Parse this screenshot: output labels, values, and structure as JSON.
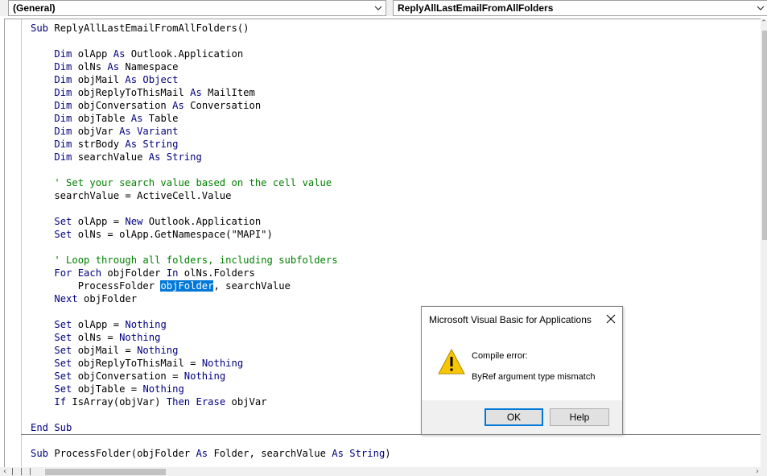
{
  "toolbar": {
    "object_combo": "(General)",
    "procedure_combo": "ReplyAllLastEmailFromAllFolders"
  },
  "code": {
    "lines": [
      [
        {
          "t": "Sub ",
          "c": "kw"
        },
        {
          "t": "ReplyAllLastEmailFromAllFolders()"
        }
      ],
      [],
      [
        {
          "t": "    "
        },
        {
          "t": "Dim",
          "c": "kw"
        },
        {
          "t": " olApp "
        },
        {
          "t": "As",
          "c": "kw"
        },
        {
          "t": " Outlook.Application"
        }
      ],
      [
        {
          "t": "    "
        },
        {
          "t": "Dim",
          "c": "kw"
        },
        {
          "t": " olNs "
        },
        {
          "t": "As",
          "c": "kw"
        },
        {
          "t": " Namespace"
        }
      ],
      [
        {
          "t": "    "
        },
        {
          "t": "Dim",
          "c": "kw"
        },
        {
          "t": " objMail "
        },
        {
          "t": "As Object",
          "c": "kw"
        }
      ],
      [
        {
          "t": "    "
        },
        {
          "t": "Dim",
          "c": "kw"
        },
        {
          "t": " objReplyToThisMail "
        },
        {
          "t": "As",
          "c": "kw"
        },
        {
          "t": " MailItem"
        }
      ],
      [
        {
          "t": "    "
        },
        {
          "t": "Dim",
          "c": "kw"
        },
        {
          "t": " objConversation "
        },
        {
          "t": "As",
          "c": "kw"
        },
        {
          "t": " Conversation"
        }
      ],
      [
        {
          "t": "    "
        },
        {
          "t": "Dim",
          "c": "kw"
        },
        {
          "t": " objTable "
        },
        {
          "t": "As",
          "c": "kw"
        },
        {
          "t": " Table"
        }
      ],
      [
        {
          "t": "    "
        },
        {
          "t": "Dim",
          "c": "kw"
        },
        {
          "t": " objVar "
        },
        {
          "t": "As Variant",
          "c": "kw"
        }
      ],
      [
        {
          "t": "    "
        },
        {
          "t": "Dim",
          "c": "kw"
        },
        {
          "t": " strBody "
        },
        {
          "t": "As String",
          "c": "kw"
        }
      ],
      [
        {
          "t": "    "
        },
        {
          "t": "Dim",
          "c": "kw"
        },
        {
          "t": " searchValue "
        },
        {
          "t": "As String",
          "c": "kw"
        }
      ],
      [],
      [
        {
          "t": "    "
        },
        {
          "t": "' Set your search value based on the cell value",
          "c": "cm"
        }
      ],
      [
        {
          "t": "    searchValue = ActiveCell.Value"
        }
      ],
      [],
      [
        {
          "t": "    "
        },
        {
          "t": "Set",
          "c": "kw"
        },
        {
          "t": " olApp = "
        },
        {
          "t": "New",
          "c": "kw"
        },
        {
          "t": " Outlook.Application"
        }
      ],
      [
        {
          "t": "    "
        },
        {
          "t": "Set",
          "c": "kw"
        },
        {
          "t": " olNs = olApp.GetNamespace(\"MAPI\")"
        }
      ],
      [],
      [
        {
          "t": "    "
        },
        {
          "t": "' Loop through all folders, including subfolders",
          "c": "cm"
        }
      ],
      [
        {
          "t": "    "
        },
        {
          "t": "For Each",
          "c": "kw"
        },
        {
          "t": " objFolder "
        },
        {
          "t": "In",
          "c": "kw"
        },
        {
          "t": " olNs.Folders"
        }
      ],
      [
        {
          "t": "        ProcessFolder "
        },
        {
          "t": "objFolder",
          "c": "sel"
        },
        {
          "t": ", searchValue"
        }
      ],
      [
        {
          "t": "    "
        },
        {
          "t": "Next",
          "c": "kw"
        },
        {
          "t": " objFolder"
        }
      ],
      [],
      [
        {
          "t": "    "
        },
        {
          "t": "Set",
          "c": "kw"
        },
        {
          "t": " olApp = "
        },
        {
          "t": "Nothing",
          "c": "kw"
        }
      ],
      [
        {
          "t": "    "
        },
        {
          "t": "Set",
          "c": "kw"
        },
        {
          "t": " olNs = "
        },
        {
          "t": "Nothing",
          "c": "kw"
        }
      ],
      [
        {
          "t": "    "
        },
        {
          "t": "Set",
          "c": "kw"
        },
        {
          "t": " objMail = "
        },
        {
          "t": "Nothing",
          "c": "kw"
        }
      ],
      [
        {
          "t": "    "
        },
        {
          "t": "Set",
          "c": "kw"
        },
        {
          "t": " objReplyToThisMail = "
        },
        {
          "t": "Nothing",
          "c": "kw"
        }
      ],
      [
        {
          "t": "    "
        },
        {
          "t": "Set",
          "c": "kw"
        },
        {
          "t": " objConversation = "
        },
        {
          "t": "Nothing",
          "c": "kw"
        }
      ],
      [
        {
          "t": "    "
        },
        {
          "t": "Set",
          "c": "kw"
        },
        {
          "t": " objTable = "
        },
        {
          "t": "Nothing",
          "c": "kw"
        }
      ],
      [
        {
          "t": "    "
        },
        {
          "t": "If",
          "c": "kw"
        },
        {
          "t": " IsArray(objVar) "
        },
        {
          "t": "Then Erase",
          "c": "kw"
        },
        {
          "t": " objVar"
        }
      ],
      [],
      [
        {
          "t": "End Sub",
          "c": "kw"
        }
      ],
      [],
      [
        {
          "t": "Sub ",
          "c": "kw"
        },
        {
          "t": "ProcessFolder(objFolder "
        },
        {
          "t": "As",
          "c": "kw"
        },
        {
          "t": " Folder, searchValue "
        },
        {
          "t": "As String",
          "c": "kw"
        },
        {
          "t": ")"
        }
      ]
    ]
  },
  "dialog": {
    "title": "Microsoft Visual Basic for Applications",
    "message_line1": "Compile error:",
    "message_line2": "ByRef argument type mismatch",
    "ok_label": "OK",
    "help_label": "Help"
  },
  "colors": {
    "keyword": "#00007f",
    "comment": "#008000",
    "selection": "#0078d7"
  }
}
